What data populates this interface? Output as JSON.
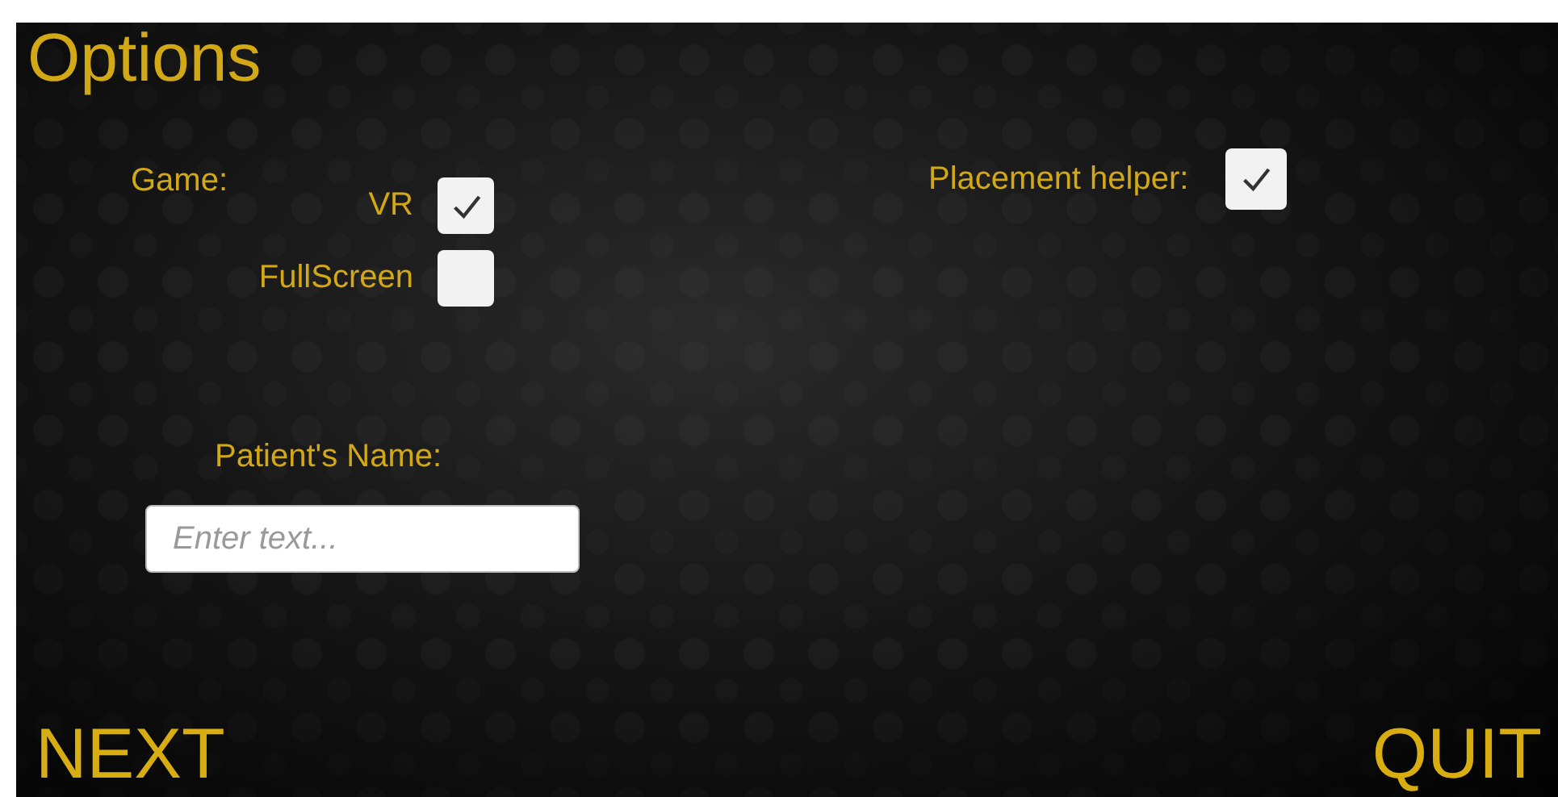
{
  "title": "Options",
  "game": {
    "label": "Game:",
    "options": [
      {
        "label": "VR",
        "checked": true
      },
      {
        "label": "FullScreen",
        "checked": false
      }
    ]
  },
  "placement_helper": {
    "label": "Placement helper:",
    "checked": true
  },
  "patient_name": {
    "label": "Patient's Name:",
    "placeholder": "Enter text..."
  },
  "buttons": [
    "NEXT",
    "QUIT"
  ]
}
